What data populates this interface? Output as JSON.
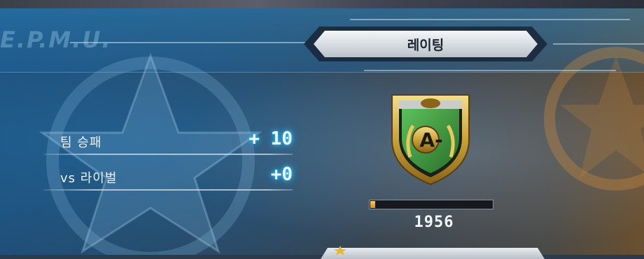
{
  "header": {
    "emblem_text": "E.P.M.U.",
    "title": "레이팅"
  },
  "stats": [
    {
      "label": "팀 승패",
      "value": "+ 10"
    },
    {
      "label": "vs 라이벌",
      "value": "+0"
    }
  ],
  "rating": {
    "grade": "A-",
    "score": "1956",
    "progress_fraction": 0.04
  },
  "colors": {
    "accent_glow": "#2fd0ff",
    "progress_fill": "#e08a10",
    "badge_gold": "#c9a23a",
    "badge_green": "#3a8f3a"
  },
  "icons": {
    "badge": "rank-shield-icon",
    "background_star": "federation-star-icon"
  }
}
